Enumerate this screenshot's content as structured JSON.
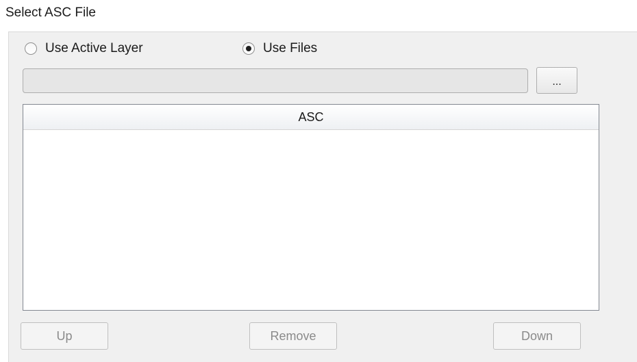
{
  "group": {
    "title": "Select ASC File"
  },
  "source_options": {
    "active_layer_label": "Use Active Layer",
    "files_label": "Use Files",
    "selected": "Use Files"
  },
  "path_input": {
    "value": "",
    "placeholder": ""
  },
  "browse_button": {
    "label": "..."
  },
  "file_list": {
    "column_header": "ASC",
    "rows": []
  },
  "actions": {
    "up_label": "Up",
    "remove_label": "Remove",
    "down_label": "Down"
  }
}
